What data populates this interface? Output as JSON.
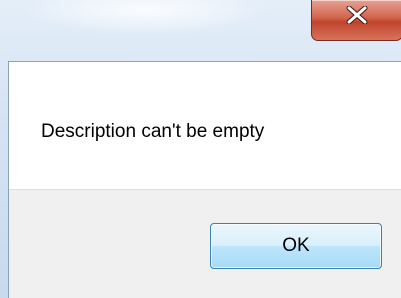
{
  "dialog": {
    "close_icon": "close-x-icon",
    "message": "Description can't be empty",
    "ok_label": "OK"
  },
  "colors": {
    "close_button": "#c7503a",
    "ok_button_border": "#3c7fb1",
    "footer_background": "#f0f0f0"
  }
}
